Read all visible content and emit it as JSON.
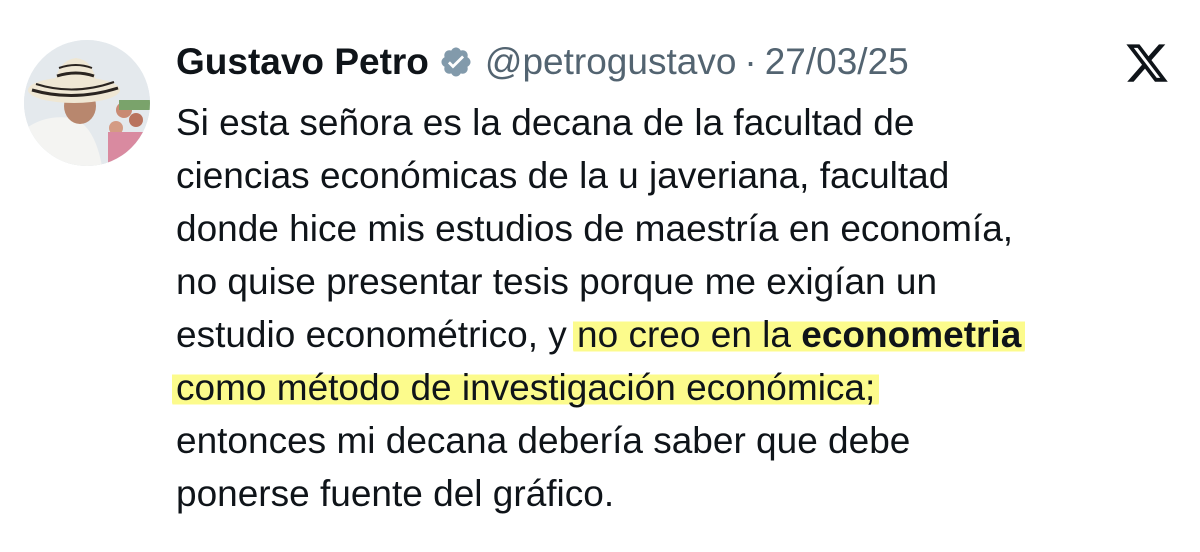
{
  "tweet": {
    "author_name": "Gustavo Petro",
    "handle": "@petrogustavo",
    "separator": "·",
    "date": "27/03/25",
    "verified_icon": "verified-badge-icon",
    "platform_icon": "x-logo-icon",
    "body": {
      "line1": "Si esta señora es la decana de la facultad de",
      "line2": "ciencias económicas de la u javeriana, facultad",
      "line3": "donde hice mis estudios de maestría en economía,",
      "line4": "no quise presentar tesis porque me exigían un",
      "line5_plain": "estudio econométrico, y ",
      "line5_highlight_plain": "no creo en la ",
      "line5_highlight_bold": "econometria",
      "line6_highlight": "como método de investigación económica;",
      "line7": "entonces mi decana debería saber que debe",
      "line8": "ponerse fuente del gráfico."
    }
  },
  "colors": {
    "text": "#0f1419",
    "muted": "#536471",
    "verified": "#829aab",
    "highlight": "#fcfa78"
  }
}
